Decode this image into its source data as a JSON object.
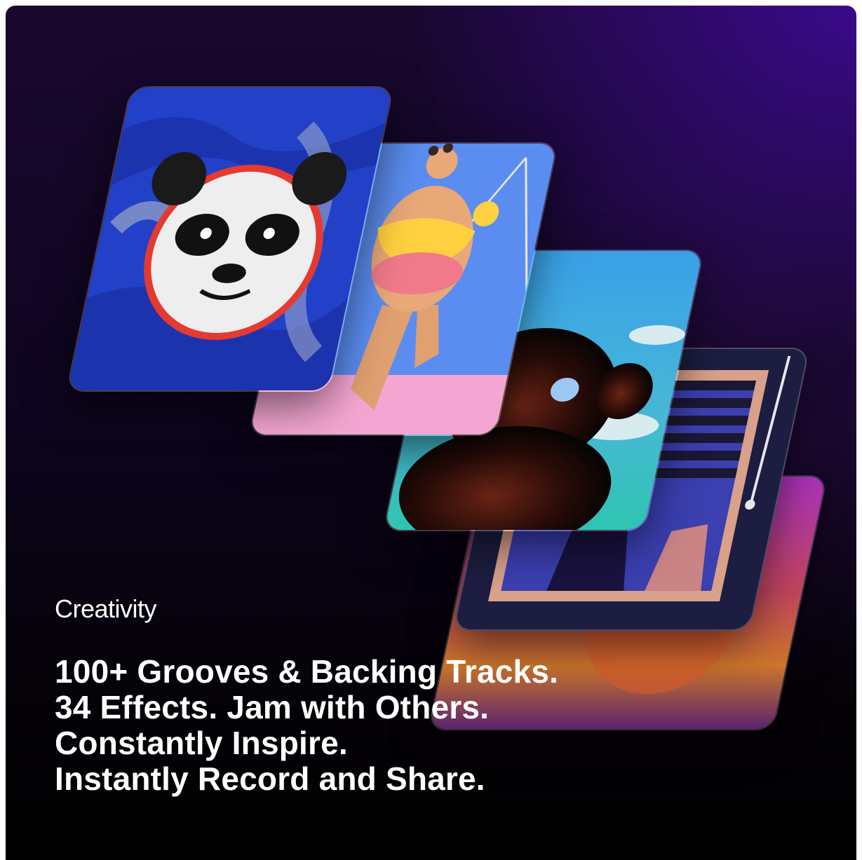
{
  "caption": "Creativity",
  "headline": [
    "100+ Grooves & Backing Tracks.",
    "34 Effects. Jam with Others.",
    "Constantly Inspire.",
    "Instantly Record and Share."
  ],
  "artwork_cards": [
    {
      "icon": "panda-artwork-icon"
    },
    {
      "icon": "swimmer-artwork-icon"
    },
    {
      "icon": "bear-silhouette-artwork-icon"
    },
    {
      "icon": "window-blinds-artwork-icon"
    },
    {
      "icon": "sunset-gradient-artwork-icon"
    }
  ],
  "colors": {
    "background_top_right": "#3a0a8a",
    "background_bottom": "#000000",
    "text": "#ffffff"
  }
}
